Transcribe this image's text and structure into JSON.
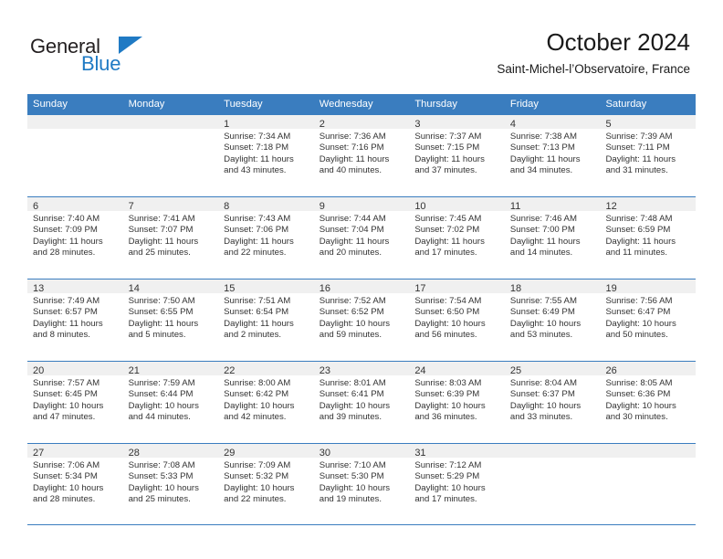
{
  "brand": {
    "name_part1": "General",
    "name_part2": "Blue",
    "accent_color": "#1f7ac4"
  },
  "header": {
    "title": "October 2024",
    "subtitle": "Saint-Michel-l’Observatoire, France"
  },
  "calendar": {
    "header_bg": "#3a7dbf",
    "weekdays": [
      "Sunday",
      "Monday",
      "Tuesday",
      "Wednesday",
      "Thursday",
      "Friday",
      "Saturday"
    ],
    "weeks": [
      [
        {
          "day": "",
          "lines": []
        },
        {
          "day": "",
          "lines": []
        },
        {
          "day": "1",
          "lines": [
            "Sunrise: 7:34 AM",
            "Sunset: 7:18 PM",
            "Daylight: 11 hours",
            "and 43 minutes."
          ]
        },
        {
          "day": "2",
          "lines": [
            "Sunrise: 7:36 AM",
            "Sunset: 7:16 PM",
            "Daylight: 11 hours",
            "and 40 minutes."
          ]
        },
        {
          "day": "3",
          "lines": [
            "Sunrise: 7:37 AM",
            "Sunset: 7:15 PM",
            "Daylight: 11 hours",
            "and 37 minutes."
          ]
        },
        {
          "day": "4",
          "lines": [
            "Sunrise: 7:38 AM",
            "Sunset: 7:13 PM",
            "Daylight: 11 hours",
            "and 34 minutes."
          ]
        },
        {
          "day": "5",
          "lines": [
            "Sunrise: 7:39 AM",
            "Sunset: 7:11 PM",
            "Daylight: 11 hours",
            "and 31 minutes."
          ]
        }
      ],
      [
        {
          "day": "6",
          "lines": [
            "Sunrise: 7:40 AM",
            "Sunset: 7:09 PM",
            "Daylight: 11 hours",
            "and 28 minutes."
          ]
        },
        {
          "day": "7",
          "lines": [
            "Sunrise: 7:41 AM",
            "Sunset: 7:07 PM",
            "Daylight: 11 hours",
            "and 25 minutes."
          ]
        },
        {
          "day": "8",
          "lines": [
            "Sunrise: 7:43 AM",
            "Sunset: 7:06 PM",
            "Daylight: 11 hours",
            "and 22 minutes."
          ]
        },
        {
          "day": "9",
          "lines": [
            "Sunrise: 7:44 AM",
            "Sunset: 7:04 PM",
            "Daylight: 11 hours",
            "and 20 minutes."
          ]
        },
        {
          "day": "10",
          "lines": [
            "Sunrise: 7:45 AM",
            "Sunset: 7:02 PM",
            "Daylight: 11 hours",
            "and 17 minutes."
          ]
        },
        {
          "day": "11",
          "lines": [
            "Sunrise: 7:46 AM",
            "Sunset: 7:00 PM",
            "Daylight: 11 hours",
            "and 14 minutes."
          ]
        },
        {
          "day": "12",
          "lines": [
            "Sunrise: 7:48 AM",
            "Sunset: 6:59 PM",
            "Daylight: 11 hours",
            "and 11 minutes."
          ]
        }
      ],
      [
        {
          "day": "13",
          "lines": [
            "Sunrise: 7:49 AM",
            "Sunset: 6:57 PM",
            "Daylight: 11 hours",
            "and 8 minutes."
          ]
        },
        {
          "day": "14",
          "lines": [
            "Sunrise: 7:50 AM",
            "Sunset: 6:55 PM",
            "Daylight: 11 hours",
            "and 5 minutes."
          ]
        },
        {
          "day": "15",
          "lines": [
            "Sunrise: 7:51 AM",
            "Sunset: 6:54 PM",
            "Daylight: 11 hours",
            "and 2 minutes."
          ]
        },
        {
          "day": "16",
          "lines": [
            "Sunrise: 7:52 AM",
            "Sunset: 6:52 PM",
            "Daylight: 10 hours",
            "and 59 minutes."
          ]
        },
        {
          "day": "17",
          "lines": [
            "Sunrise: 7:54 AM",
            "Sunset: 6:50 PM",
            "Daylight: 10 hours",
            "and 56 minutes."
          ]
        },
        {
          "day": "18",
          "lines": [
            "Sunrise: 7:55 AM",
            "Sunset: 6:49 PM",
            "Daylight: 10 hours",
            "and 53 minutes."
          ]
        },
        {
          "day": "19",
          "lines": [
            "Sunrise: 7:56 AM",
            "Sunset: 6:47 PM",
            "Daylight: 10 hours",
            "and 50 minutes."
          ]
        }
      ],
      [
        {
          "day": "20",
          "lines": [
            "Sunrise: 7:57 AM",
            "Sunset: 6:45 PM",
            "Daylight: 10 hours",
            "and 47 minutes."
          ]
        },
        {
          "day": "21",
          "lines": [
            "Sunrise: 7:59 AM",
            "Sunset: 6:44 PM",
            "Daylight: 10 hours",
            "and 44 minutes."
          ]
        },
        {
          "day": "22",
          "lines": [
            "Sunrise: 8:00 AM",
            "Sunset: 6:42 PM",
            "Daylight: 10 hours",
            "and 42 minutes."
          ]
        },
        {
          "day": "23",
          "lines": [
            "Sunrise: 8:01 AM",
            "Sunset: 6:41 PM",
            "Daylight: 10 hours",
            "and 39 minutes."
          ]
        },
        {
          "day": "24",
          "lines": [
            "Sunrise: 8:03 AM",
            "Sunset: 6:39 PM",
            "Daylight: 10 hours",
            "and 36 minutes."
          ]
        },
        {
          "day": "25",
          "lines": [
            "Sunrise: 8:04 AM",
            "Sunset: 6:37 PM",
            "Daylight: 10 hours",
            "and 33 minutes."
          ]
        },
        {
          "day": "26",
          "lines": [
            "Sunrise: 8:05 AM",
            "Sunset: 6:36 PM",
            "Daylight: 10 hours",
            "and 30 minutes."
          ]
        }
      ],
      [
        {
          "day": "27",
          "lines": [
            "Sunrise: 7:06 AM",
            "Sunset: 5:34 PM",
            "Daylight: 10 hours",
            "and 28 minutes."
          ]
        },
        {
          "day": "28",
          "lines": [
            "Sunrise: 7:08 AM",
            "Sunset: 5:33 PM",
            "Daylight: 10 hours",
            "and 25 minutes."
          ]
        },
        {
          "day": "29",
          "lines": [
            "Sunrise: 7:09 AM",
            "Sunset: 5:32 PM",
            "Daylight: 10 hours",
            "and 22 minutes."
          ]
        },
        {
          "day": "30",
          "lines": [
            "Sunrise: 7:10 AM",
            "Sunset: 5:30 PM",
            "Daylight: 10 hours",
            "and 19 minutes."
          ]
        },
        {
          "day": "31",
          "lines": [
            "Sunrise: 7:12 AM",
            "Sunset: 5:29 PM",
            "Daylight: 10 hours",
            "and 17 minutes."
          ]
        },
        {
          "day": "",
          "lines": []
        },
        {
          "day": "",
          "lines": []
        }
      ]
    ]
  }
}
